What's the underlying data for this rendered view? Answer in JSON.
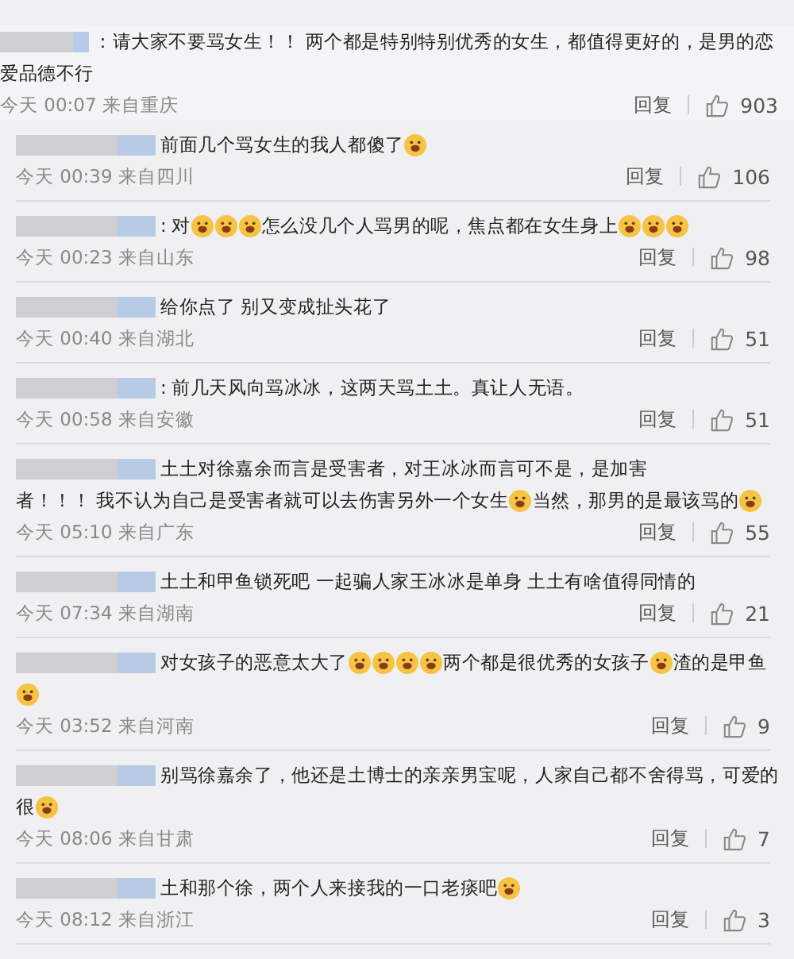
{
  "comments": [
    {
      "kind": "comment",
      "lines": [
        [
          {
            "kind": "text",
            "text": "：请大家不要骂女生！！ 两个都是特别特别优秀的女生，都值得更好的，是男的恋"
          }
        ],
        [
          {
            "kind": "text",
            "text": "爱品德不行"
          }
        ]
      ],
      "time": "今天 00:07 来自重庆",
      "reply": "回复",
      "likes": "903"
    },
    {
      "kind": "reply",
      "lines": [
        [
          {
            "kind": "text",
            "text": "前面几个骂女生的我人都傻了"
          },
          {
            "kind": "emoji"
          }
        ]
      ],
      "time": "今天 00:39 来自四川",
      "reply": "回复",
      "likes": "106"
    },
    {
      "kind": "reply",
      "lines": [
        [
          {
            "kind": "text",
            "text": ": 对"
          },
          {
            "kind": "emoji"
          },
          {
            "kind": "emoji"
          },
          {
            "kind": "emoji"
          },
          {
            "kind": "text",
            "text": "怎么没几个人骂男的呢，焦点都在女生身上"
          },
          {
            "kind": "emoji"
          },
          {
            "kind": "emoji"
          },
          {
            "kind": "emoji"
          }
        ]
      ],
      "time": "今天 00:23 来自山东",
      "reply": "回复",
      "likes": "98"
    },
    {
      "kind": "reply",
      "lines": [
        [
          {
            "kind": "text",
            "text": "给你点了 别又变成扯头花了"
          }
        ]
      ],
      "time": "今天 00:40 来自湖北",
      "reply": "回复",
      "likes": "51"
    },
    {
      "kind": "reply",
      "lines": [
        [
          {
            "kind": "text",
            "text": ": 前几天风向骂冰冰，这两天骂土土。真让人无语。"
          }
        ]
      ],
      "time": "今天 00:58 来自安徽",
      "reply": "回复",
      "likes": "51"
    },
    {
      "kind": "reply",
      "lines": [
        [
          {
            "kind": "text",
            "text": "土土对徐嘉余而言是受害者，对王冰冰而言可不是，是加害"
          }
        ],
        [
          {
            "kind": "text",
            "text": "者！！！ 我不认为自己是受害者就可以去伤害另外一个女生"
          },
          {
            "kind": "emoji"
          },
          {
            "kind": "text",
            "text": "当然，那男的是最该骂的"
          },
          {
            "kind": "emoji"
          }
        ]
      ],
      "time": "今天 05:10 来自广东",
      "reply": "回复",
      "likes": "55"
    },
    {
      "kind": "reply",
      "lines": [
        [
          {
            "kind": "text",
            "text": "土土和甲鱼锁死吧 一起骗人家王冰冰是单身 土土有啥值得同情的"
          }
        ]
      ],
      "time": "今天 07:34 来自湖南",
      "reply": "回复",
      "likes": "21"
    },
    {
      "kind": "reply",
      "lines": [
        [
          {
            "kind": "text",
            "text": "对女孩子的恶意太大了"
          },
          {
            "kind": "emoji"
          },
          {
            "kind": "emoji"
          },
          {
            "kind": "emoji"
          },
          {
            "kind": "emoji"
          },
          {
            "kind": "text",
            "text": "两个都是很优秀的女孩子"
          },
          {
            "kind": "emoji"
          },
          {
            "kind": "text",
            "text": "渣的是甲鱼"
          }
        ],
        [
          {
            "kind": "emoji"
          }
        ]
      ],
      "time": "今天 03:52 来自河南",
      "reply": "回复",
      "likes": "9"
    },
    {
      "kind": "reply",
      "lines": [
        [
          {
            "kind": "text",
            "text": "别骂徐嘉余了，他还是土博士的亲亲男宝呢，人家自己都不舍得骂，可爱的"
          }
        ],
        [
          {
            "kind": "text",
            "text": "很"
          },
          {
            "kind": "emoji"
          }
        ]
      ],
      "time": "今天 08:06 来自甘肃",
      "reply": "回复",
      "likes": "7"
    },
    {
      "kind": "reply",
      "lines": [
        [
          {
            "kind": "text",
            "text": "土和那个徐，两个人来接我的一口老痰吧"
          },
          {
            "kind": "emoji"
          }
        ]
      ],
      "time": "今天 08:12 来自浙江",
      "reply": "回复",
      "likes": "3"
    }
  ]
}
